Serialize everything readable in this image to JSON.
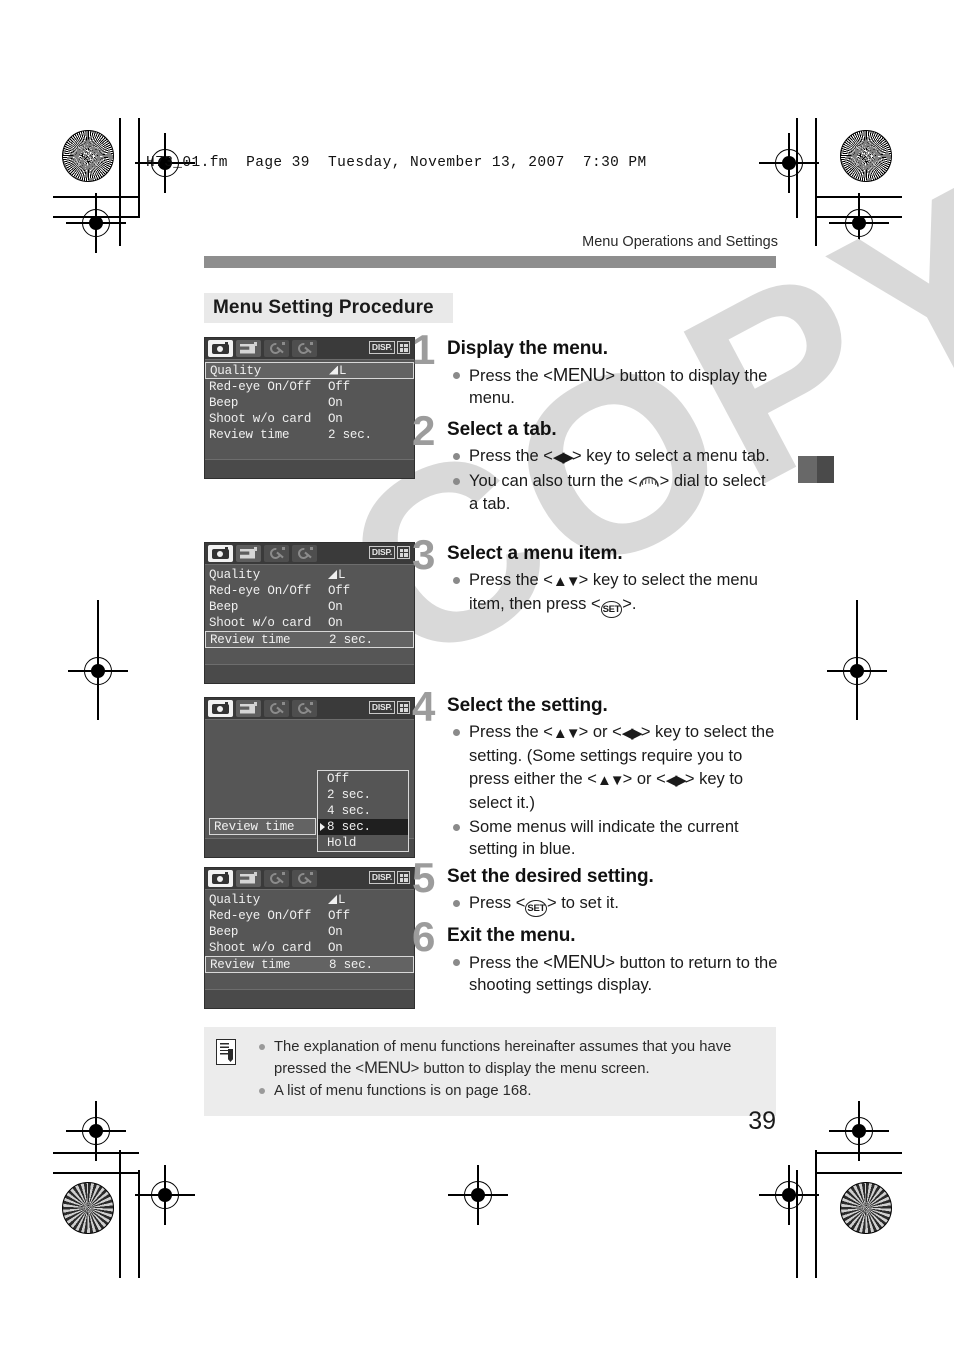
{
  "print_header": "H73_01.fm  Page 39  Tuesday, November 13, 2007  7:30 PM",
  "running_head": "Menu Operations and Settings",
  "section_title": "Menu Setting Procedure",
  "page_number": "39",
  "watermark": "COPY",
  "colors": {
    "rule": "#8e8e8e",
    "section_bg": "#e9e9e9",
    "step_number": "#9c9c9c",
    "note_bg": "#ececec",
    "lcd_bg": "#565656",
    "watermark": "#d9d9d9"
  },
  "lcd_common": {
    "disp_label": "DISP.",
    "tabs": [
      {
        "name": "shooting-tab",
        "state": "active"
      },
      {
        "name": "playback-tab",
        "state": "inactive"
      },
      {
        "name": "setup1-tab",
        "state": "dim"
      },
      {
        "name": "setup2-tab",
        "state": "dim"
      }
    ]
  },
  "screens": {
    "screen1": {
      "rows": [
        {
          "label": "Quality",
          "value": "L",
          "has_quality_icon": true,
          "selected": true
        },
        {
          "label": "Red-eye On/Off",
          "value": "Off",
          "selected": false
        },
        {
          "label": "Beep",
          "value": "On",
          "selected": false
        },
        {
          "label": "Shoot w/o card",
          "value": "On",
          "selected": false
        },
        {
          "label": "Review time",
          "value": "2 sec.",
          "selected": false
        }
      ]
    },
    "screen3": {
      "rows": [
        {
          "label": "Quality",
          "value": "L",
          "has_quality_icon": true,
          "selected": false
        },
        {
          "label": "Red-eye On/Off",
          "value": "Off",
          "selected": false
        },
        {
          "label": "Beep",
          "value": "On",
          "selected": false
        },
        {
          "label": "Shoot w/o card",
          "value": "On",
          "selected": false
        },
        {
          "label": "Review time",
          "value": "2 sec.",
          "selected": true
        }
      ]
    },
    "screen4": {
      "left_label": "Review time",
      "options": [
        {
          "label": "Off",
          "current": false
        },
        {
          "label": "2 sec.",
          "current": false
        },
        {
          "label": "4 sec.",
          "current": false
        },
        {
          "label": "8 sec.",
          "current": true
        },
        {
          "label": "Hold",
          "current": false
        }
      ]
    },
    "screen5": {
      "rows": [
        {
          "label": "Quality",
          "value": "L",
          "has_quality_icon": true,
          "selected": false
        },
        {
          "label": "Red-eye On/Off",
          "value": "Off",
          "selected": false
        },
        {
          "label": "Beep",
          "value": "On",
          "selected": false
        },
        {
          "label": "Shoot w/o card",
          "value": "On",
          "selected": false
        },
        {
          "label": "Review time",
          "value": "8 sec.",
          "selected": true
        }
      ]
    }
  },
  "steps": {
    "step1": {
      "number": "1",
      "title": "Display the menu.",
      "b1_pre": "Press the <",
      "b1_key": "MENU",
      "b1_post": "> button to display the menu."
    },
    "step2": {
      "number": "2",
      "title": "Select a tab.",
      "b1_pre": "Press the <",
      "b1_key": "◀▶",
      "b1_post": "> key to select a menu tab.",
      "b2_pre": "You can also turn the <",
      "b2_post": "> dial to select a tab."
    },
    "step3": {
      "number": "3",
      "title": "Select a menu item.",
      "b1_pre": "Press the <",
      "b1_key": "▲▼",
      "b1_mid": "> key to select the menu item, then press <",
      "b1_set": "SET",
      "b1_post": ">."
    },
    "step4": {
      "number": "4",
      "title": "Select the setting.",
      "b1_p1": "Press the <",
      "b1_k1": "▲▼",
      "b1_p2": "> or <",
      "b1_k2": "◀▶",
      "b1_p3": "> key to select the setting. (Some settings require you to press either the <",
      "b1_k3": "▲▼",
      "b1_p4": "> or <",
      "b1_k4": "◀▶",
      "b1_p5": "> key to select it.)",
      "b2": "Some menus will indicate the current setting in blue."
    },
    "step5": {
      "number": "5",
      "title": "Set the desired setting.",
      "b1_pre": "Press <",
      "b1_set": "SET",
      "b1_post": "> to set it."
    },
    "step6": {
      "number": "6",
      "title": "Exit the menu.",
      "b1_pre": "Press the <",
      "b1_key": "MENU",
      "b1_post": "> button to return to the shooting settings display."
    }
  },
  "note": {
    "b1_pre": "The explanation of menu functions hereinafter assumes that you have pressed the <",
    "b1_key": "MENU",
    "b1_post": "> button to display the menu screen.",
    "b2": "A list of menu functions is on page 168."
  }
}
